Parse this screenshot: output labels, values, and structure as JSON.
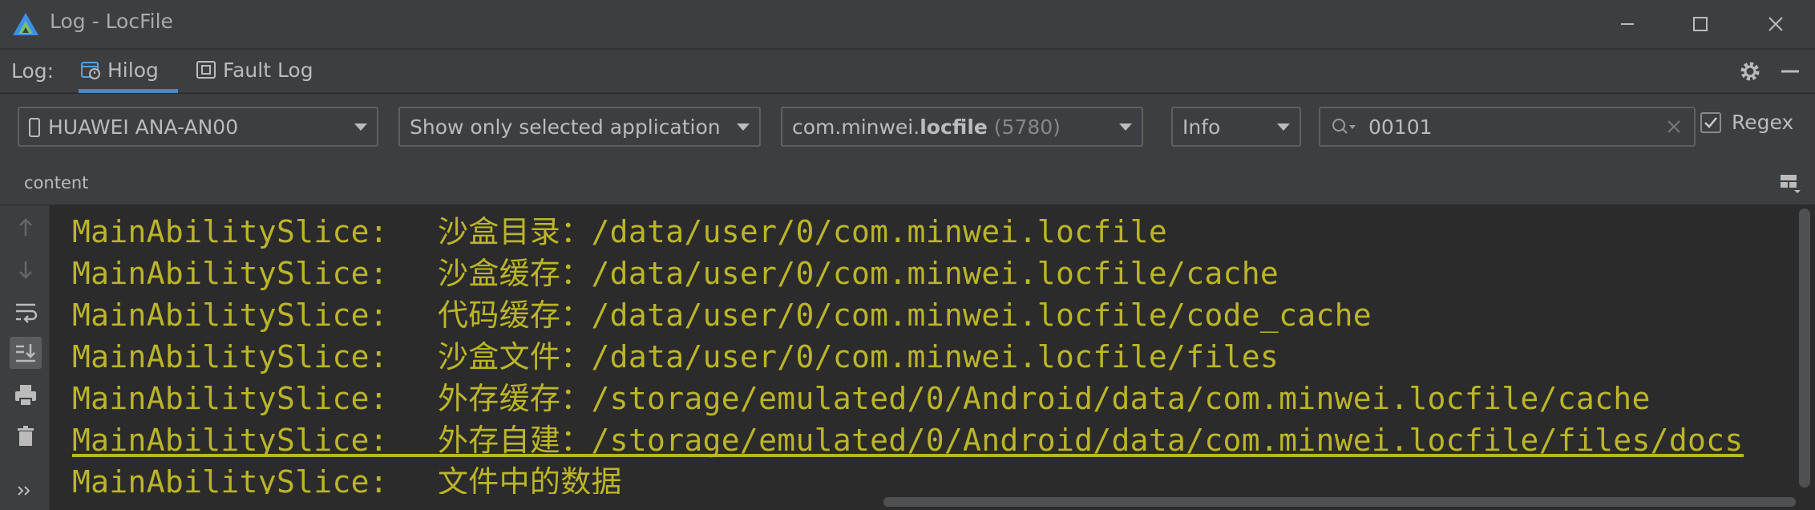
{
  "window": {
    "title": "Log - LocFile",
    "controls": [
      "minimize-icon",
      "maximize-icon",
      "close-icon"
    ]
  },
  "logbar": {
    "label": "Log:",
    "tabs": [
      {
        "label": "Hilog",
        "icon": "hilog-icon",
        "active": true
      },
      {
        "label": "Fault Log",
        "icon": "fault-log-icon",
        "active": false
      }
    ],
    "actions": [
      "gear-icon",
      "hide-icon"
    ]
  },
  "filters": {
    "device": {
      "label": "HUAWEI ANA-AN00",
      "icon": "phone-icon"
    },
    "scope": {
      "label": "Show only selected application"
    },
    "process": {
      "prefix": "com.minwei.",
      "bold": "locfile",
      "pid": "(5780)"
    },
    "level": {
      "label": "Info"
    },
    "search": {
      "value": "00101",
      "icon": "search-icon"
    },
    "regex": {
      "label": "Regex",
      "checked": true
    }
  },
  "columns": {
    "label": "content"
  },
  "gutter": {
    "icons": [
      "up-arrow-icon",
      "down-arrow-icon",
      "soft-wrap-icon",
      "scroll-to-end-icon",
      "print-icon",
      "trash-icon",
      "more-icon"
    ]
  },
  "console": {
    "lines": [
      {
        "tag": "MainAbilitySlice:",
        "message": "沙盒目录：/data/user/0/com.minwei.locfile"
      },
      {
        "tag": "MainAbilitySlice:",
        "message": "沙盒缓存：/data/user/0/com.minwei.locfile/cache"
      },
      {
        "tag": "MainAbilitySlice:",
        "message": "代码缓存：/data/user/0/com.minwei.locfile/code_cache"
      },
      {
        "tag": "MainAbilitySlice:",
        "message": "沙盒文件：/data/user/0/com.minwei.locfile/files"
      },
      {
        "tag": "MainAbilitySlice:",
        "message": "外存缓存：/storage/emulated/0/Android/data/com.minwei.locfile/cache"
      },
      {
        "tag": "MainAbilitySlice:",
        "message": "外存自建：/storage/emulated/0/Android/data/com.minwei.locfile/files/docs"
      },
      {
        "tag": "MainAbilitySlice:",
        "message": "文件中的数据"
      }
    ]
  },
  "colors": {
    "log_text": "#bbb529",
    "active_tab": "#4a88c7",
    "panel_bg": "#3c3f41",
    "console_bg": "#2b2b2b"
  }
}
